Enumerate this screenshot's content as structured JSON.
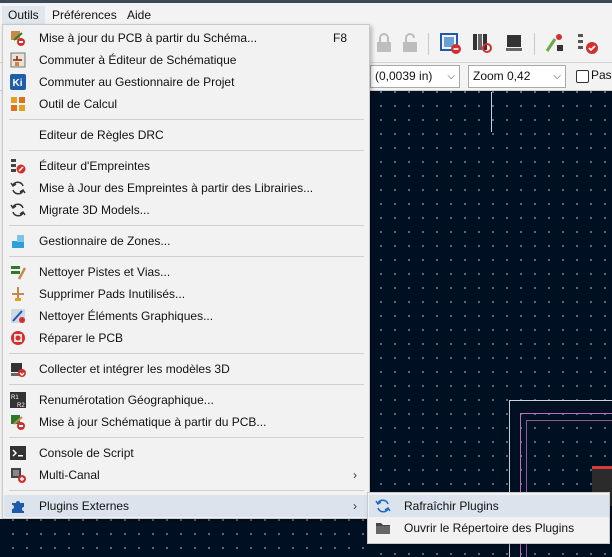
{
  "menubar": {
    "items": [
      {
        "label": "Outils",
        "active": true
      },
      {
        "label": "Préférences",
        "active": false
      },
      {
        "label": "Aide",
        "active": false
      }
    ]
  },
  "toolbar2": {
    "grid_value": "(0,0039 in)",
    "zoom_value": "Zoom 0,42",
    "checkbox_label": "Pass"
  },
  "menu": {
    "items": [
      {
        "label": "Mise à jour du PCB à partir du  Schéma...",
        "shortcut": "F8",
        "icon": "update-pcb-icon"
      },
      {
        "label": "Commuter à Éditeur de Schématique",
        "icon": "schematic-editor-icon"
      },
      {
        "label": "Commuter au Gestionnaire de Projet",
        "icon": "kicad-project-icon"
      },
      {
        "label": "Outil de Calcul",
        "icon": "calculator-icon"
      },
      {
        "label": "Editeur de Règles DRC",
        "icon": ""
      },
      {
        "label": "Éditeur d'Empreintes",
        "icon": "footprint-editor-icon"
      },
      {
        "label": "Mise à Jour des Empreintes à partir des Librairies...",
        "icon": "refresh-footprints-icon"
      },
      {
        "label": "Migrate 3D Models...",
        "icon": "migrate-3d-icon"
      },
      {
        "label": "Gestionnaire de Zones...",
        "icon": "zone-manager-icon"
      },
      {
        "label": "Nettoyer Pistes et Vias...",
        "icon": "cleanup-tracks-icon"
      },
      {
        "label": "Supprimer Pads Inutilisés...",
        "icon": "remove-pads-icon"
      },
      {
        "label": "Nettoyer Éléments Graphiques...",
        "icon": "cleanup-graphics-icon"
      },
      {
        "label": "Réparer le PCB",
        "icon": "repair-pcb-icon"
      },
      {
        "label": "Collecter et intégrer les modèles 3D",
        "icon": "collect-3d-icon"
      },
      {
        "label": "Renumérotation Géographique...",
        "icon": "renumber-icon"
      },
      {
        "label": "Mise à jour Schématique à partir du PCB...",
        "icon": "update-schematic-icon"
      },
      {
        "label": "Console de Script",
        "icon": "script-console-icon"
      },
      {
        "label": "Multi-Canal",
        "icon": "multichannel-icon",
        "submenu": true
      },
      {
        "label": "Plugins Externes",
        "icon": "plugins-icon",
        "submenu": true,
        "highlighted": true
      }
    ]
  },
  "submenu": {
    "items": [
      {
        "label": "Rafraîchir Plugins",
        "icon": "refresh-plugins-icon",
        "highlighted": true
      },
      {
        "label": "Ouvrir le Répertoire des Plugins",
        "icon": "folder-icon"
      }
    ]
  },
  "submenu_arrow": "›",
  "colors": {
    "canvas_bg": "#001023",
    "menu_bg": "#f2f2f2",
    "highlight": "#dbe3ec",
    "board_outline": "#c46bbf"
  }
}
